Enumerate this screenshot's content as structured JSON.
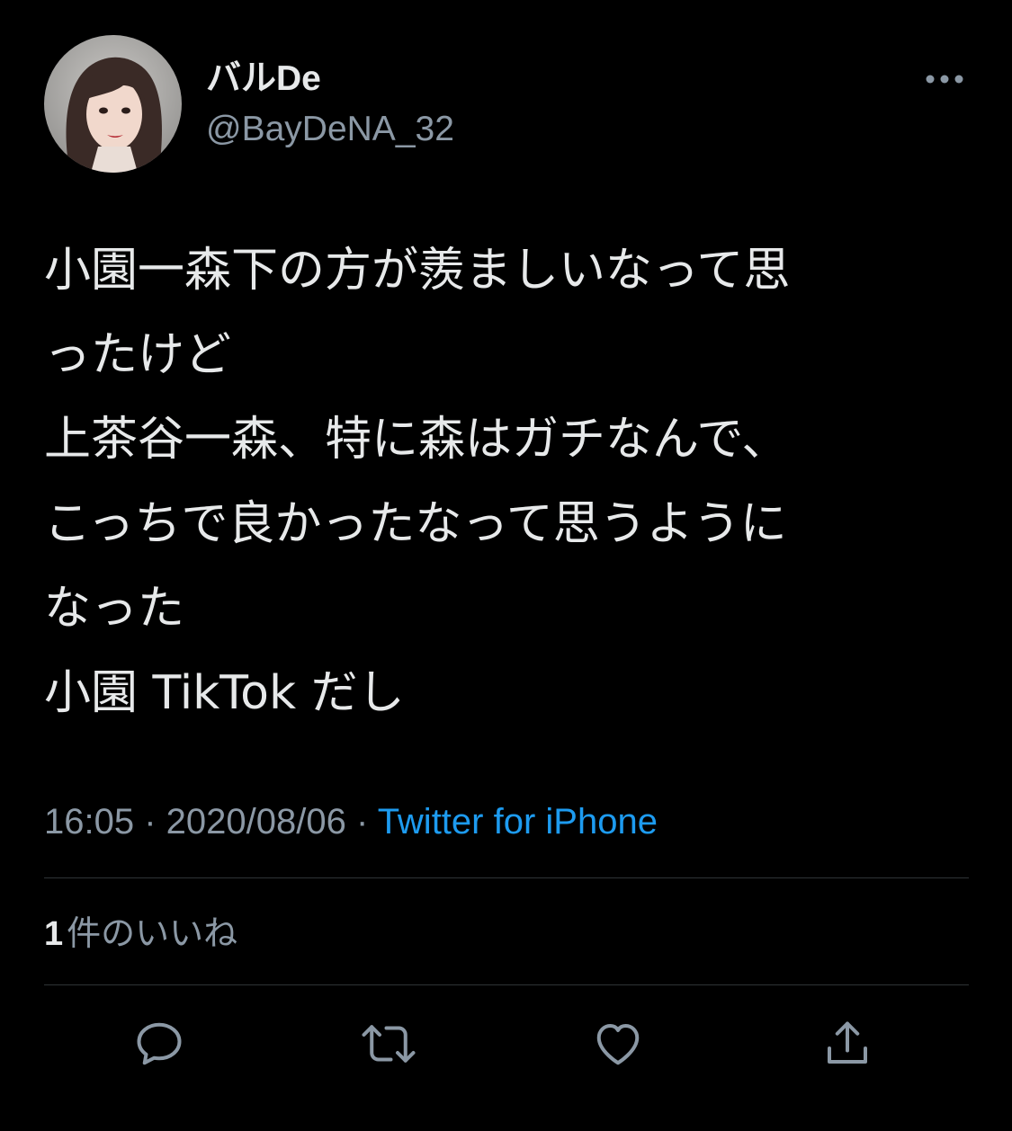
{
  "user": {
    "display_name": "バルDe",
    "handle": "@BayDeNA_32"
  },
  "tweet": {
    "lines": [
      "小園一森下の方が羨ましいなって思",
      "ったけど",
      "上茶谷一森、特に森はガチなんで、",
      "こっちで良かったなって思うように",
      "なった",
      "小園 TikTok だし"
    ]
  },
  "meta": {
    "time": "16:05",
    "separator": " · ",
    "date": "2020/08/06",
    "source": "Twitter for iPhone"
  },
  "likes": {
    "count": "1",
    "label": "件のいいね"
  },
  "actions": {
    "reply_icon": "reply-icon",
    "retweet_icon": "retweet-icon",
    "like_icon": "heart-icon",
    "share_icon": "share-icon"
  },
  "colors": {
    "background": "#000000",
    "text": "#e7e9ea",
    "secondary": "#8b98a5",
    "accent": "#1d9bf0",
    "divider": "#2f3336"
  }
}
